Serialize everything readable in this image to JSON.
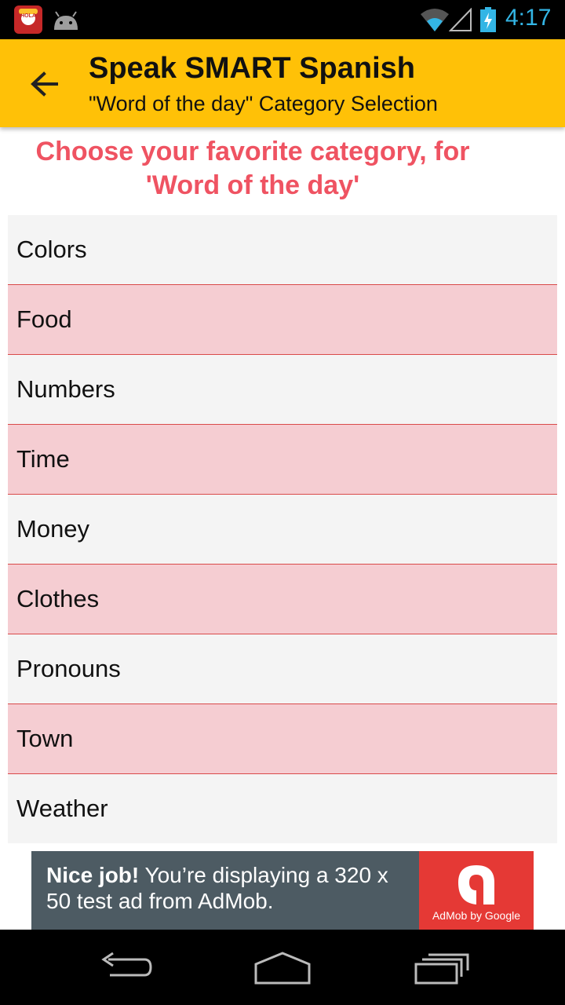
{
  "status_bar": {
    "app_icon_text": "HOLA",
    "time": "4:17",
    "icons": [
      "app-notification-icon",
      "android-icon",
      "wifi-icon",
      "signal-icon",
      "battery-charging-icon"
    ]
  },
  "app_bar": {
    "title": "Speak SMART Spanish",
    "subtitle": "\"Word of the day\" Category Selection",
    "back_icon": "arrow-back-icon",
    "color": "#ffc107"
  },
  "heading": {
    "line1": "Choose your  favorite  category, for",
    "line2": "'Word of the day'",
    "color": "#ef5362"
  },
  "categories": [
    "Colors",
    "Food",
    "Numbers",
    "Time",
    "Money",
    "Clothes",
    "Pronouns",
    "Town",
    "Weather"
  ],
  "list_colors": {
    "odd": "#f4f4f4",
    "even": "#f5cdd2",
    "divider": "#d94a4a"
  },
  "ad": {
    "bold_text": "Nice job!",
    "text": " You’re displaying a 320 x 50 test ad from AdMob.",
    "logo_label": "AdMob by Google"
  },
  "nav_bar": {
    "icons": [
      "back-nav-icon",
      "home-nav-icon",
      "recents-nav-icon"
    ]
  }
}
